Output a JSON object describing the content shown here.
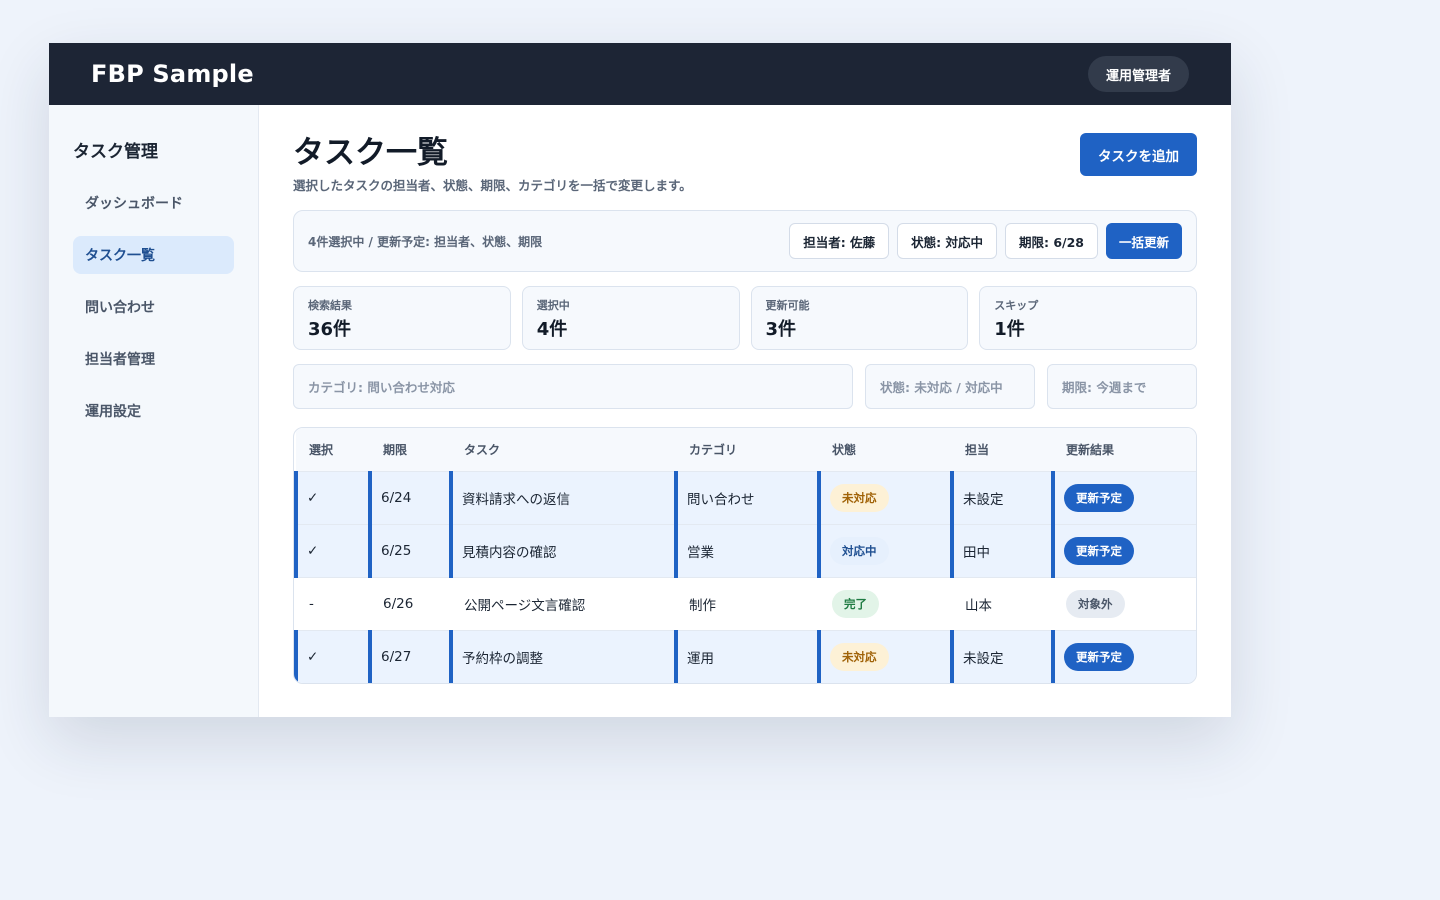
{
  "app": {
    "title": "FBP Sample",
    "role": "運用管理者"
  },
  "sidebar": {
    "heading": "タスク管理",
    "items": [
      {
        "label": "ダッシュボード"
      },
      {
        "label": "タスク一覧"
      },
      {
        "label": "問い合わせ"
      },
      {
        "label": "担当者管理"
      },
      {
        "label": "運用設定"
      }
    ]
  },
  "header": {
    "title": "タスク一覧",
    "subtitle": "選択したタスクの担当者、状態、期限、カテゴリを一括で変更します。",
    "add_button": "タスクを追加"
  },
  "bulk": {
    "summary": "4件選択中 / 更新予定: 担当者、状態、期限",
    "assignee": "担当者: 佐藤",
    "status": "状態: 対応中",
    "due": "期限: 6/28",
    "apply": "一括更新"
  },
  "stats": [
    {
      "label": "検索結果",
      "value": "36件"
    },
    {
      "label": "選択中",
      "value": "4件"
    },
    {
      "label": "更新可能",
      "value": "3件"
    },
    {
      "label": "スキップ",
      "value": "1件"
    }
  ],
  "filters": {
    "category": "カテゴリ: 問い合わせ対応",
    "status": "状態: 未対応 / 対応中",
    "due": "期限: 今週まで"
  },
  "table": {
    "headers": [
      "選択",
      "期限",
      "タスク",
      "カテゴリ",
      "状態",
      "担当",
      "更新結果"
    ],
    "rows": [
      {
        "select": "✓",
        "due": "6/24",
        "task": "資料請求への返信",
        "category": "問い合わせ",
        "status": "未対応",
        "assignee": "未設定",
        "result": "更新予定"
      },
      {
        "select": "✓",
        "due": "6/25",
        "task": "見積内容の確認",
        "category": "営業",
        "status": "対応中",
        "assignee": "田中",
        "result": "更新予定"
      },
      {
        "select": "-",
        "due": "6/26",
        "task": "公開ページ文言確認",
        "category": "制作",
        "status": "完了",
        "assignee": "山本",
        "result": "対象外"
      },
      {
        "select": "✓",
        "due": "6/27",
        "task": "予約枠の調整",
        "category": "運用",
        "status": "未対応",
        "assignee": "未設定",
        "result": "更新予定"
      }
    ]
  },
  "colors": {
    "primary": "#1f62c4",
    "topbar": "#1d2535",
    "status_open": "#a06207",
    "status_progress": "#1f4f91",
    "status_done": "#1e7b42"
  }
}
